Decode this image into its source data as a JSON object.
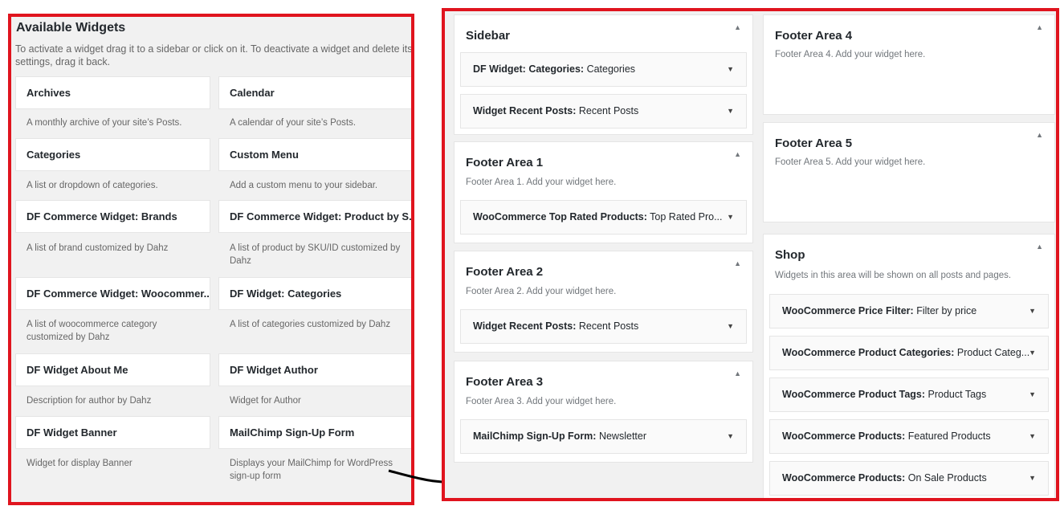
{
  "available": {
    "title": "Available Widgets",
    "description": "To activate a widget drag it to a sidebar or click on it. To deactivate a widget and delete its settings, drag it back.",
    "widgets": [
      {
        "name": "Archives",
        "desc": "A monthly archive of your site’s Posts."
      },
      {
        "name": "Calendar",
        "desc": "A calendar of your site’s Posts."
      },
      {
        "name": "Categories",
        "desc": "A list or dropdown of categories."
      },
      {
        "name": "Custom Menu",
        "desc": "Add a custom menu to your sidebar."
      },
      {
        "name": "DF Commerce Widget: Brands",
        "desc": "A list of brand customized by Dahz"
      },
      {
        "name": "DF Commerce Widget: Product by S...",
        "desc": "A list of product by SKU/ID customized by Dahz"
      },
      {
        "name": "DF Commerce Widget: Woocommer...",
        "desc": "A list of woocommerce category customized by Dahz"
      },
      {
        "name": "DF Widget: Categories",
        "desc": "A list of categories customized by Dahz"
      },
      {
        "name": "DF Widget About Me",
        "desc": "Description for author by Dahz"
      },
      {
        "name": "DF Widget Author",
        "desc": "Widget for Author"
      },
      {
        "name": "DF Widget Banner",
        "desc": "Widget for display Banner"
      },
      {
        "name": "MailChimp Sign-Up Form",
        "desc": "Displays your MailChimp for WordPress sign-up form"
      }
    ]
  },
  "areas": {
    "sidebar": {
      "title": "Sidebar",
      "widgets": [
        {
          "type": "DF Widget: Categories:",
          "title": "Categories"
        },
        {
          "type": "Widget Recent Posts:",
          "title": "Recent Posts"
        }
      ]
    },
    "footer1": {
      "title": "Footer Area 1",
      "desc": "Footer Area 1. Add your widget here.",
      "widgets": [
        {
          "type": "WooCommerce Top Rated Products:",
          "title": "Top Rated Pro..."
        }
      ]
    },
    "footer2": {
      "title": "Footer Area 2",
      "desc": "Footer Area 2. Add your widget here.",
      "widgets": [
        {
          "type": "Widget Recent Posts:",
          "title": "Recent Posts"
        }
      ]
    },
    "footer3": {
      "title": "Footer Area 3",
      "desc": "Footer Area 3. Add your widget here.",
      "widgets": [
        {
          "type": "MailChimp Sign-Up Form:",
          "title": "Newsletter"
        }
      ]
    },
    "footer4": {
      "title": "Footer Area 4",
      "desc": "Footer Area 4. Add your widget here."
    },
    "footer5": {
      "title": "Footer Area 5",
      "desc": "Footer Area 5. Add your widget here."
    },
    "shop": {
      "title": "Shop",
      "desc": "Widgets in this area will be shown on all posts and pages.",
      "widgets": [
        {
          "type": "WooCommerce Price Filter:",
          "title": "Filter by price"
        },
        {
          "type": "WooCommerce Product Categories:",
          "title": "Product Categ..."
        },
        {
          "type": "WooCommerce Product Tags:",
          "title": "Product Tags"
        },
        {
          "type": "WooCommerce Products:",
          "title": "Featured Products"
        },
        {
          "type": "WooCommerce Products:",
          "title": "On Sale Products"
        }
      ]
    }
  },
  "icons": {
    "collapse": "▲",
    "expand": "▼"
  },
  "colors": {
    "highlight_border": "#e0141e",
    "panel_bg": "#f1f1f1"
  }
}
